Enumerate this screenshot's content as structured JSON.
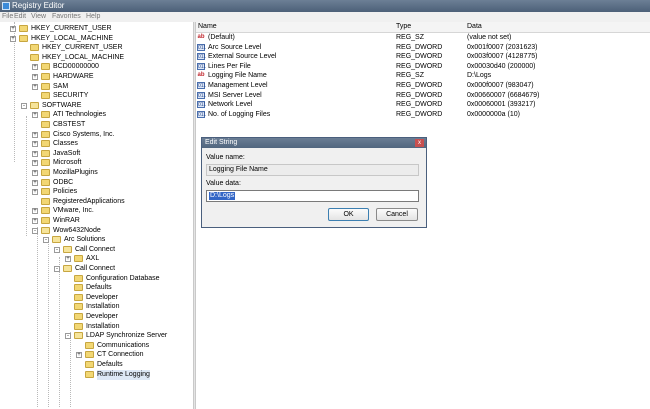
{
  "window": {
    "title": "Registry Editor"
  },
  "menu": [
    "File",
    "Edit",
    "View",
    "Favorites",
    "Help"
  ],
  "tree": [
    {
      "label": "HKEY_CURRENT_USER",
      "expander": "+"
    },
    {
      "label": "HKEY_LOCAL_MACHINE",
      "expander": "+"
    },
    {
      "label": "HKEY_CURRENT_USER",
      "expander": ""
    },
    {
      "label": "HKEY_LOCAL_MACHINE",
      "expander": ""
    },
    {
      "label": "BCD00000000",
      "expander": "+"
    },
    {
      "label": "HARDWARE",
      "expander": "+"
    },
    {
      "label": "SAM",
      "expander": "+"
    },
    {
      "label": "SECURITY",
      "expander": ""
    },
    {
      "label": "SOFTWARE",
      "expander": "-"
    },
    {
      "label": "ATI Technologies",
      "expander": "+"
    },
    {
      "label": "CBSTEST",
      "expander": ""
    },
    {
      "label": "Cisco Systems, Inc.",
      "expander": "+"
    },
    {
      "label": "Classes",
      "expander": "+"
    },
    {
      "label": "JavaSoft",
      "expander": "+"
    },
    {
      "label": "Microsoft",
      "expander": "+"
    },
    {
      "label": "MozillaPlugins",
      "expander": "+"
    },
    {
      "label": "ODBC",
      "expander": "+"
    },
    {
      "label": "Policies",
      "expander": "+"
    },
    {
      "label": "RegisteredApplications",
      "expander": ""
    },
    {
      "label": "VMware, Inc.",
      "expander": "+"
    },
    {
      "label": "WinRAR",
      "expander": "+"
    },
    {
      "label": "Wow6432Node",
      "expander": "-"
    },
    {
      "label": "Arc Solutions",
      "expander": "-"
    },
    {
      "label": "Call Connect",
      "expander": "-"
    },
    {
      "label": "AXL",
      "expander": "+"
    },
    {
      "label": "Call Connect",
      "expander": "-"
    },
    {
      "label": "Configuration Database",
      "expander": ""
    },
    {
      "label": "Defaults",
      "expander": ""
    },
    {
      "label": "Developer",
      "expander": ""
    },
    {
      "label": "Installation",
      "expander": ""
    },
    {
      "label": "Developer",
      "expander": ""
    },
    {
      "label": "Installation",
      "expander": ""
    },
    {
      "label": "LDAP Synchronize Server",
      "expander": "-"
    },
    {
      "label": "Communications",
      "expander": ""
    },
    {
      "label": "CT Connection",
      "expander": "+"
    },
    {
      "label": "Defaults",
      "expander": ""
    },
    {
      "label": "Runtime Logging",
      "expander": ""
    }
  ],
  "list": {
    "columns": {
      "name": "Name",
      "type": "Type",
      "data": "Data"
    },
    "rows": [
      {
        "icon": "ab",
        "name": "(Default)",
        "type": "REG_SZ",
        "data": "(value not set)"
      },
      {
        "icon": "dword",
        "name": "Arc Source Level",
        "type": "REG_DWORD",
        "data": "0x001f0007 (2031623)"
      },
      {
        "icon": "dword",
        "name": "External Source Level",
        "type": "REG_DWORD",
        "data": "0x003f0007 (4128775)"
      },
      {
        "icon": "dword",
        "name": "Lines Per File",
        "type": "REG_DWORD",
        "data": "0x00030d40 (200000)"
      },
      {
        "icon": "ab",
        "name": "Logging File Name",
        "type": "REG_SZ",
        "data": "D:\\Logs"
      },
      {
        "icon": "dword",
        "name": "Management Level",
        "type": "REG_DWORD",
        "data": "0x000f0007 (983047)"
      },
      {
        "icon": "dword",
        "name": "MSI Server Level",
        "type": "REG_DWORD",
        "data": "0x00660007 (6684679)"
      },
      {
        "icon": "dword",
        "name": "Network Level",
        "type": "REG_DWORD",
        "data": "0x00060001 (393217)"
      },
      {
        "icon": "dword",
        "name": "No. of Logging Files",
        "type": "REG_DWORD",
        "data": "0x0000000a (10)"
      }
    ]
  },
  "dialog": {
    "title": "Edit String",
    "close_glyph": "x",
    "value_name_label": "Value name:",
    "value_name": "Logging File Name",
    "value_data_label": "Value data:",
    "value_data": "D:\\Logs",
    "ok_label": "OK",
    "cancel_label": "Cancel"
  }
}
